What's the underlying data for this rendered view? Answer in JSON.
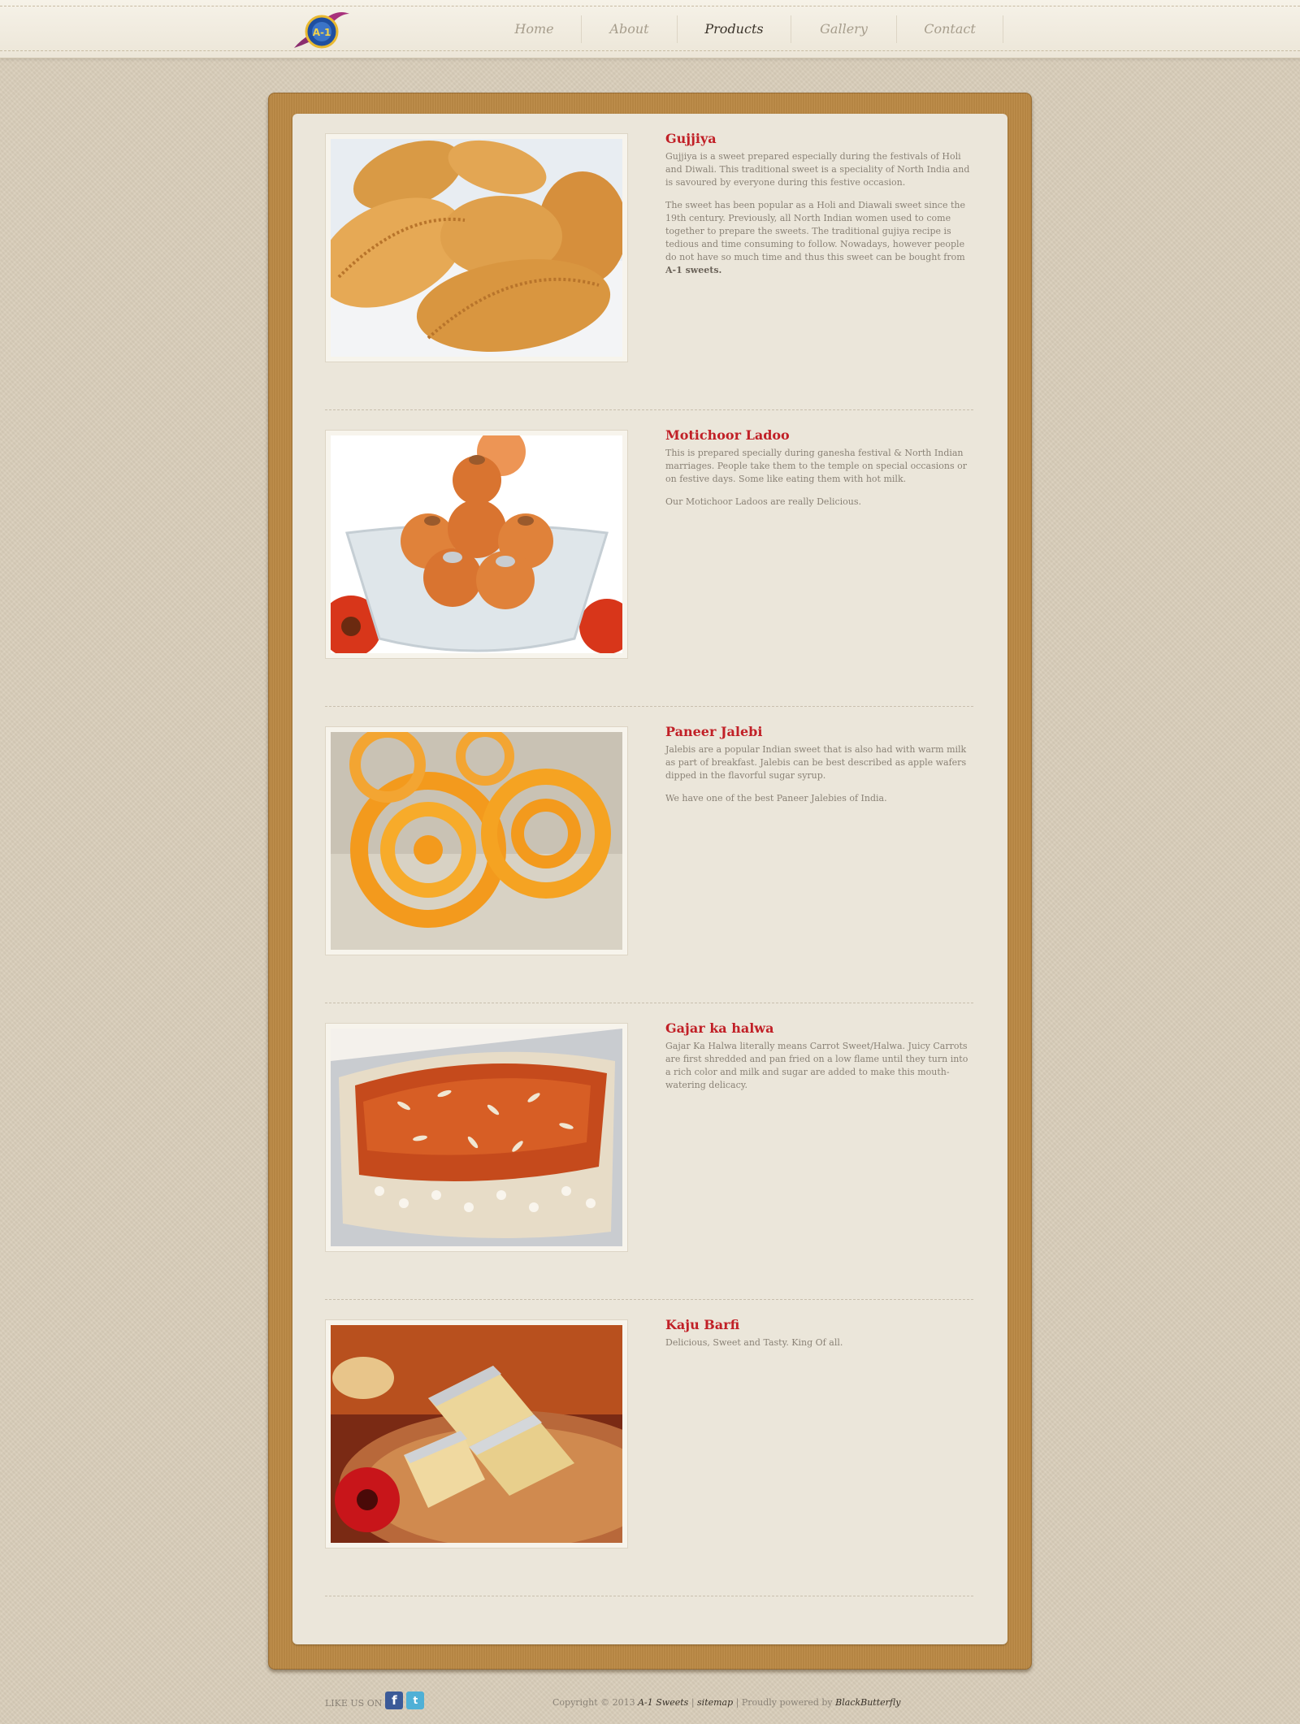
{
  "header": {
    "logo_text": "A-1",
    "nav": [
      {
        "label": "Home"
      },
      {
        "label": "About"
      },
      {
        "label": "Products",
        "active": true
      },
      {
        "label": "Gallery"
      },
      {
        "label": "Contact"
      }
    ]
  },
  "products": [
    {
      "name": "Gujjiya",
      "paragraphs": [
        "Gujjiya is a sweet prepared especially during the festivals of Holi and Diwali. This traditional sweet is a speciality of North India and is savoured by everyone during this festive occasion.",
        "The sweet has been popular as a Holi and Diawali sweet since the 19th century. Previously, all North Indian women used to come together to prepare the sweets. The traditional gujiya recipe is tedious and time consuming to follow. Nowadays, however people do not have so much time and thus this sweet can be bought from"
      ],
      "highlight": "A-1 sweets."
    },
    {
      "name": "Motichoor Ladoo",
      "paragraphs": [
        "This is prepared specially during ganesha festival & North Indian marriages. People take them to the temple on special occasions or on festive days. Some like eating them with hot milk.",
        "Our Motichoor Ladoos are really Delicious."
      ]
    },
    {
      "name": "Paneer Jalebi",
      "paragraphs": [
        "Jalebis are a popular Indian sweet that is also had with warm milk as part of breakfast. Jalebis can be best described as apple wafers dipped in the flavorful sugar syrup.",
        "We have one of the best Paneer Jalebies of India."
      ]
    },
    {
      "name": "Gajar ka halwa",
      "paragraphs": [
        "Gajar Ka Halwa literally means Carrot Sweet/Halwa. Juicy Carrots are first shredded and pan fried on a low flame until they turn into a rich color and milk and sugar are added to make this mouth-watering delicacy."
      ]
    },
    {
      "name": "Kaju Barfi",
      "paragraphs": [
        "Delicious, Sweet and Tasty. King Of all."
      ]
    }
  ],
  "footer": {
    "like_label": "LIKE US ON",
    "copyright": "Copyright © 2013",
    "brand": "A-1 Sweets",
    "sep1": "|",
    "sitemap": "sitemap",
    "sep2": "| Proudly powered by",
    "powered_by": "BlackButterfly"
  },
  "colors": {
    "title_red": "#c12027",
    "frame_brown": "#bb8945",
    "panel_bg": "#ebe6da",
    "page_bg": "#d8cdb9"
  }
}
